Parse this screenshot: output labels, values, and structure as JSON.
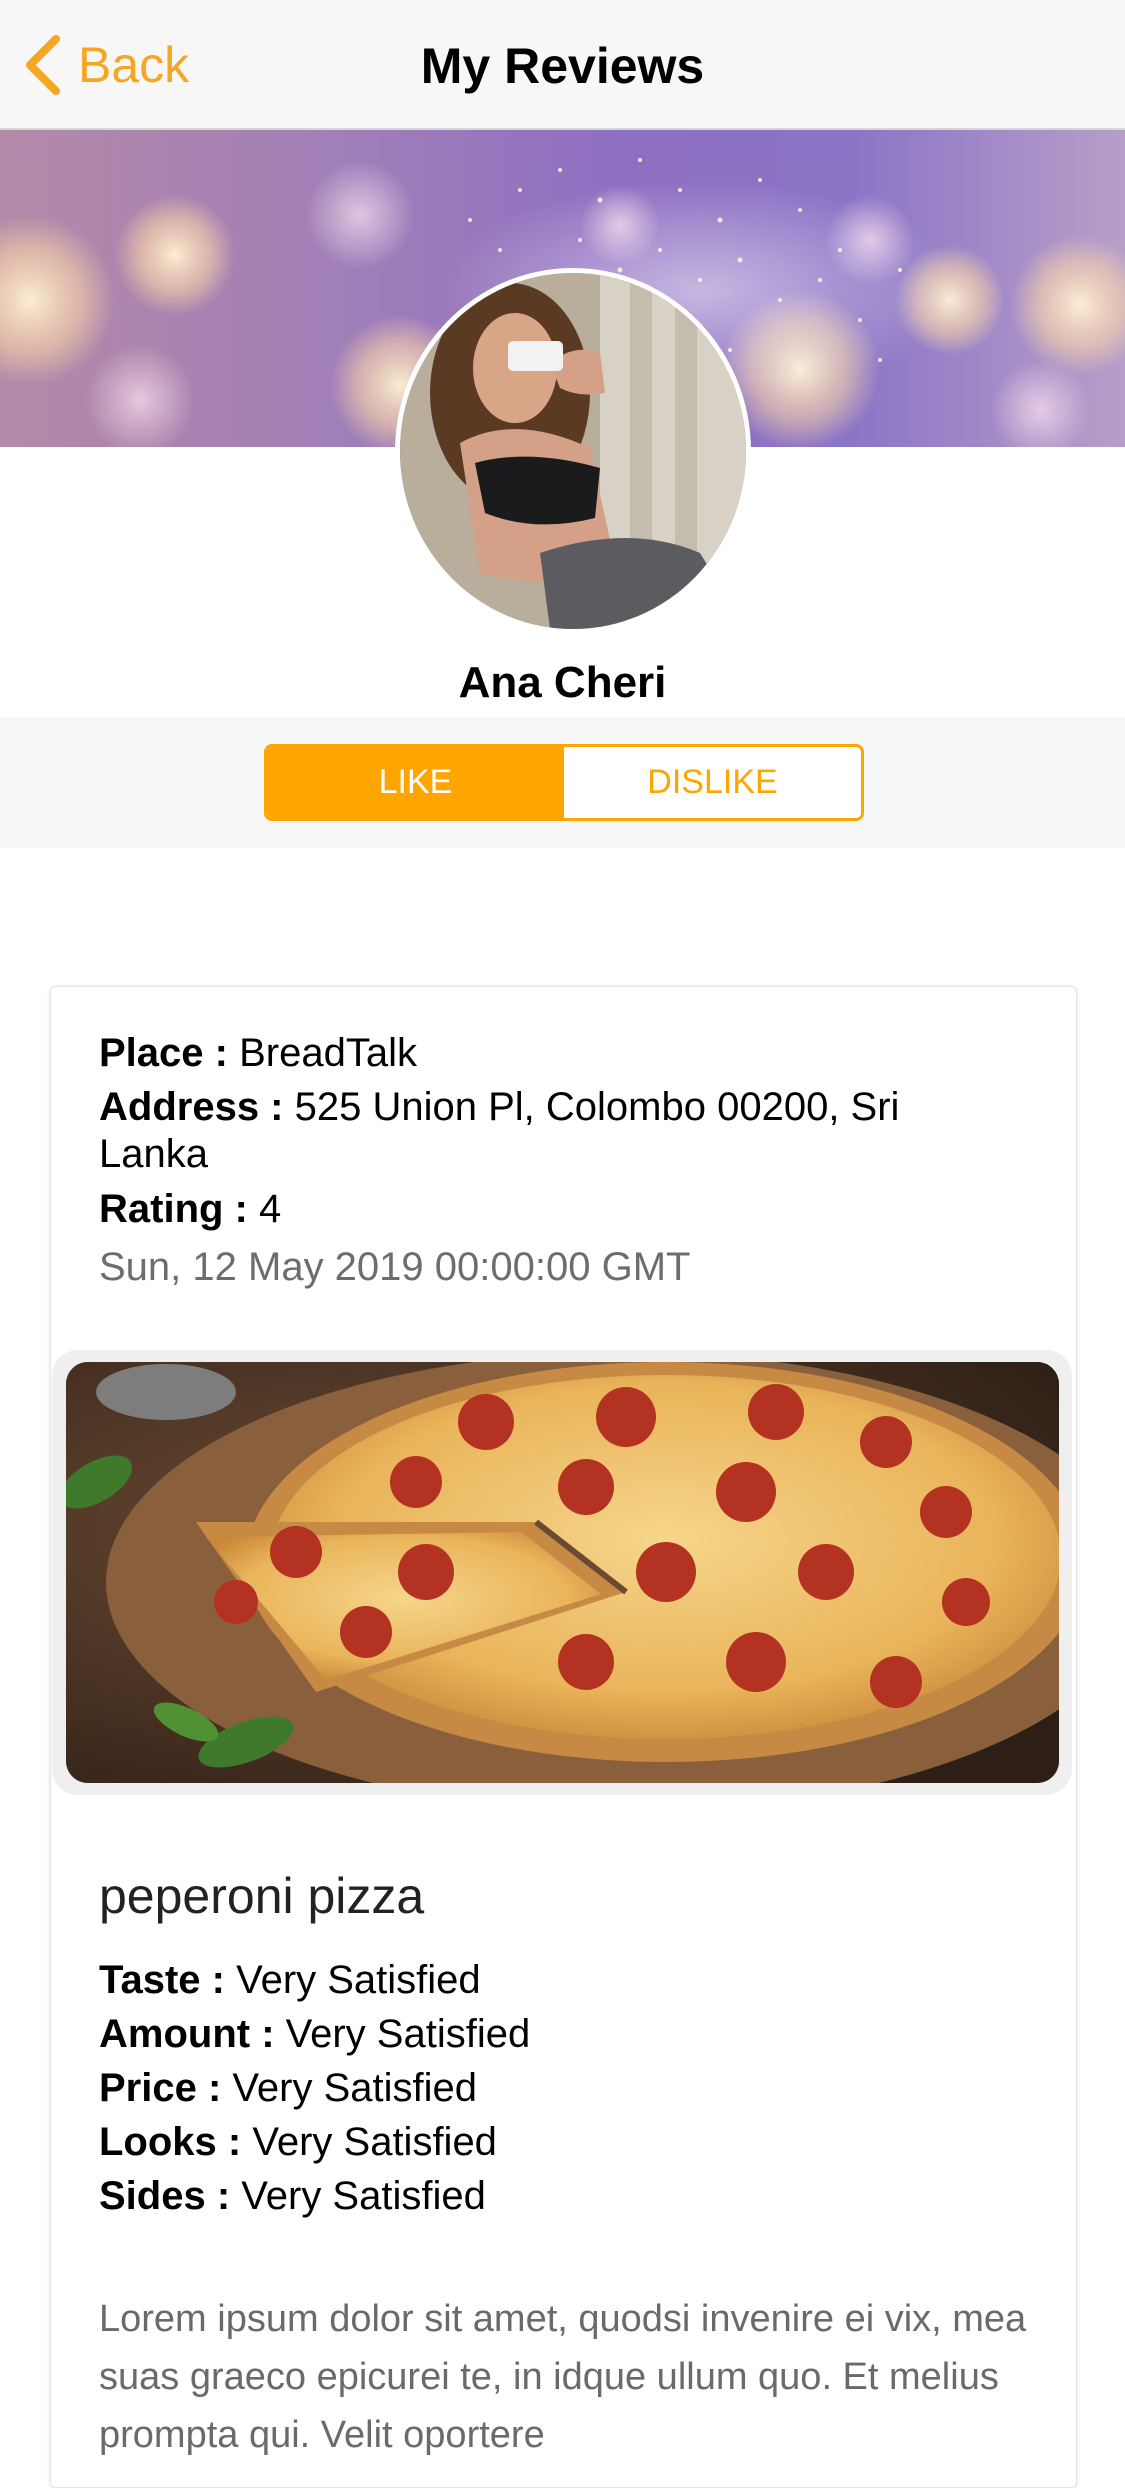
{
  "nav": {
    "back_label": "Back",
    "title": "My Reviews"
  },
  "profile": {
    "name": "Ana Cheri"
  },
  "segmented": {
    "like_label": "LIKE",
    "dislike_label": "DISLIKE",
    "selected": "LIKE"
  },
  "review": {
    "place_label": "Place :",
    "place_value": "BreadTalk",
    "address_label": "Address :",
    "address_value": "525 Union Pl, Colombo 00200, Sri Lanka",
    "rating_label": "Rating :",
    "rating_value": "4",
    "date": "Sun, 12 May 2019 00:00:00 GMT",
    "dish_name": "peperoni pizza",
    "criteria": [
      {
        "label": "Taste :",
        "value": "Very Satisfied"
      },
      {
        "label": "Amount :",
        "value": "Very Satisfied"
      },
      {
        "label": "Price :",
        "value": "Very Satisfied"
      },
      {
        "label": "Looks :",
        "value": "Very Satisfied"
      },
      {
        "label": "Sides :",
        "value": "Very Satisfied"
      }
    ],
    "comment": "Lorem ipsum dolor sit amet, quodsi invenire ei vix, mea suas graeco epicurei te, in idque ullum quo. Et melius prompta qui. Velit oportere"
  },
  "colors": {
    "accent": "#ffa500",
    "back": "#f5a623"
  }
}
